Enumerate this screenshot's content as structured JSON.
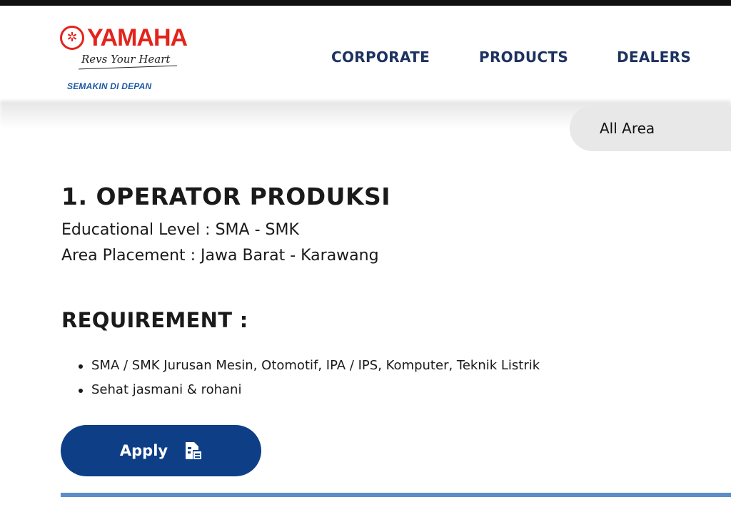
{
  "brand": {
    "name": "YAMAHA",
    "tagline": "Revs Your Heart",
    "slogan": "SEMAKIN DI DEPAN",
    "logo_icon": "tuning-fork-emblem",
    "brand_color": "#e3241b",
    "slogan_color": "#1c5aa6"
  },
  "nav": {
    "items": [
      {
        "label": "CORPORATE"
      },
      {
        "label": "PRODUCTS"
      },
      {
        "label": "DEALERS"
      }
    ],
    "color": "#1d3260"
  },
  "filter": {
    "area_selected": "All Area"
  },
  "job": {
    "title": "1. OPERATOR PRODUKSI",
    "educational_level": "Educational Level : SMA - SMK",
    "area_placement": "Area Placement : Jawa Barat - Karawang",
    "requirement_heading": "REQUIREMENT :",
    "requirements": [
      "SMA / SMK Jurusan Mesin, Otomotif, IPA / IPS, Komputer, Teknik Listrik",
      "Sehat jasmani & rohani"
    ]
  },
  "apply": {
    "label": "Apply",
    "icon": "document-form-icon",
    "color": "#0e3f86"
  },
  "divider_color": "#5b8ec9"
}
